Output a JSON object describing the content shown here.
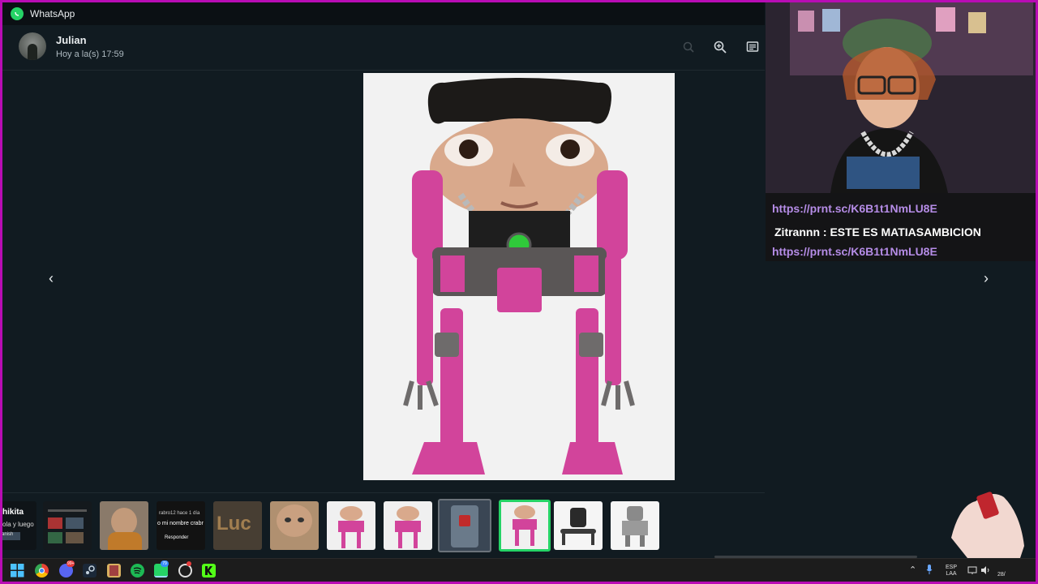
{
  "window": {
    "title": "WhatsApp"
  },
  "header": {
    "contact_name": "Julian",
    "timestamp": "Hoy a la(s) 17:59",
    "zoom_icon": "zoom-in-icon",
    "message_icon": "go-to-message-icon"
  },
  "viewer": {
    "prev_icon": "chevron-left-icon",
    "next_icon": "chevron-right-icon",
    "image_subject": "robot-with-human-face"
  },
  "stream_chat": {
    "lines": [
      {
        "type": "link",
        "text": "https://prnt.sc/K6B1t1NmLU8E"
      },
      {
        "type": "message",
        "user": "Zitrannn",
        "separator": " : ",
        "text": "ESTE ES MATIASAMBICION"
      },
      {
        "type": "link",
        "text": "https://prnt.sc/K6B1t1NmLU8E"
      }
    ]
  },
  "thumbnails": {
    "t0_line1": "hikita",
    "t0_line2": "ola y luego",
    "t0_line3": "anish",
    "t3_line1": "rabro12 hace 1 día",
    "t3_line2": "o mi nombre crabr",
    "t3_line3": "Responder",
    "t4_text": "Luc"
  },
  "taskbar": {
    "lang_line1": "ESP",
    "lang_line2": "LAA",
    "date_partial": "28/",
    "chrome_badge": "",
    "discord_badge": "99+",
    "whatsapp_badge": "79"
  },
  "colors": {
    "frame_border": "#b80cb4",
    "whatsapp_green": "#25d366",
    "chat_link": "#b58ce6",
    "background": "#111b21"
  }
}
